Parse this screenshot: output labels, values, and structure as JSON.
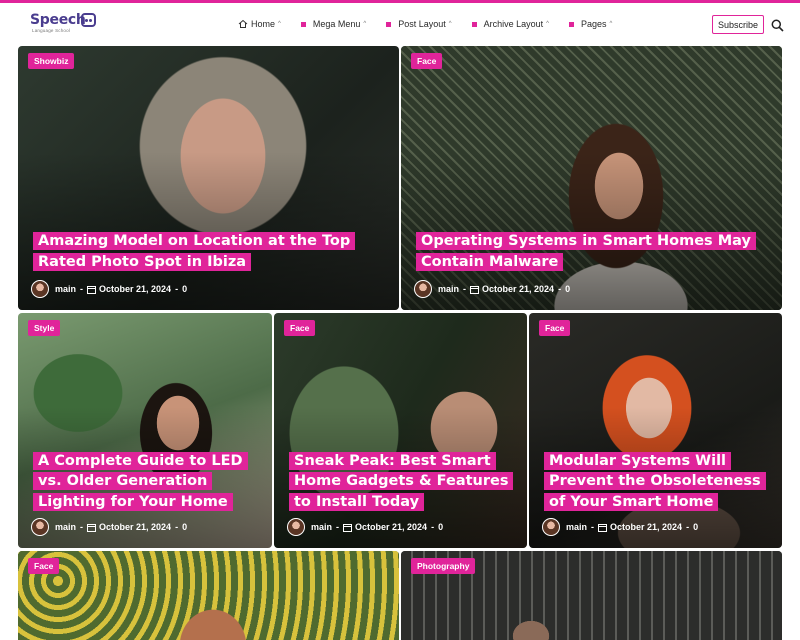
{
  "brand": {
    "name": "Speech",
    "tagline": "Language School"
  },
  "nav": {
    "items": [
      {
        "label": "Home",
        "icon": "home-icon"
      },
      {
        "label": "Mega Menu",
        "icon": "pink-square-bullet"
      },
      {
        "label": "Post Layout",
        "icon": "pink-square-bullet"
      },
      {
        "label": "Archive Layout",
        "icon": "pink-square-bullet"
      },
      {
        "label": "Pages",
        "icon": "pink-square-bullet"
      }
    ],
    "chevron": "^",
    "subscribe_label": "Subscribe",
    "search_icon": "search-icon"
  },
  "colors": {
    "accent": "#e0249a",
    "logo": "#4a3d8f"
  },
  "posts": [
    {
      "category": "Showbiz",
      "title": "Amazing Model on Location at the Top Rated Photo Spot in Ibiza",
      "author": "main",
      "date": "October 21, 2024",
      "comments": "0"
    },
    {
      "category": "Face",
      "title": "Operating Systems in Smart Homes May Contain Malware",
      "author": "main",
      "date": "October 21, 2024",
      "comments": "0"
    },
    {
      "category": "Style",
      "title": "A Complete Guide to LED vs. Older Generation Lighting for Your Home",
      "author": "main",
      "date": "October 21, 2024",
      "comments": "0"
    },
    {
      "category": "Face",
      "title": "Sneak Peak: Best Smart Home Gadgets & Features to Install Today",
      "author": "main",
      "date": "October 21, 2024",
      "comments": "0"
    },
    {
      "category": "Face",
      "title": "Modular Systems Will Prevent the Obsoleteness of Your Smart Home",
      "author": "main",
      "date": "October 21, 2024",
      "comments": "0"
    },
    {
      "category": "Face",
      "title": "",
      "author": "",
      "date": "",
      "comments": ""
    },
    {
      "category": "Photography",
      "title": "",
      "author": "",
      "date": "",
      "comments": ""
    }
  ],
  "meta_separator": "-"
}
